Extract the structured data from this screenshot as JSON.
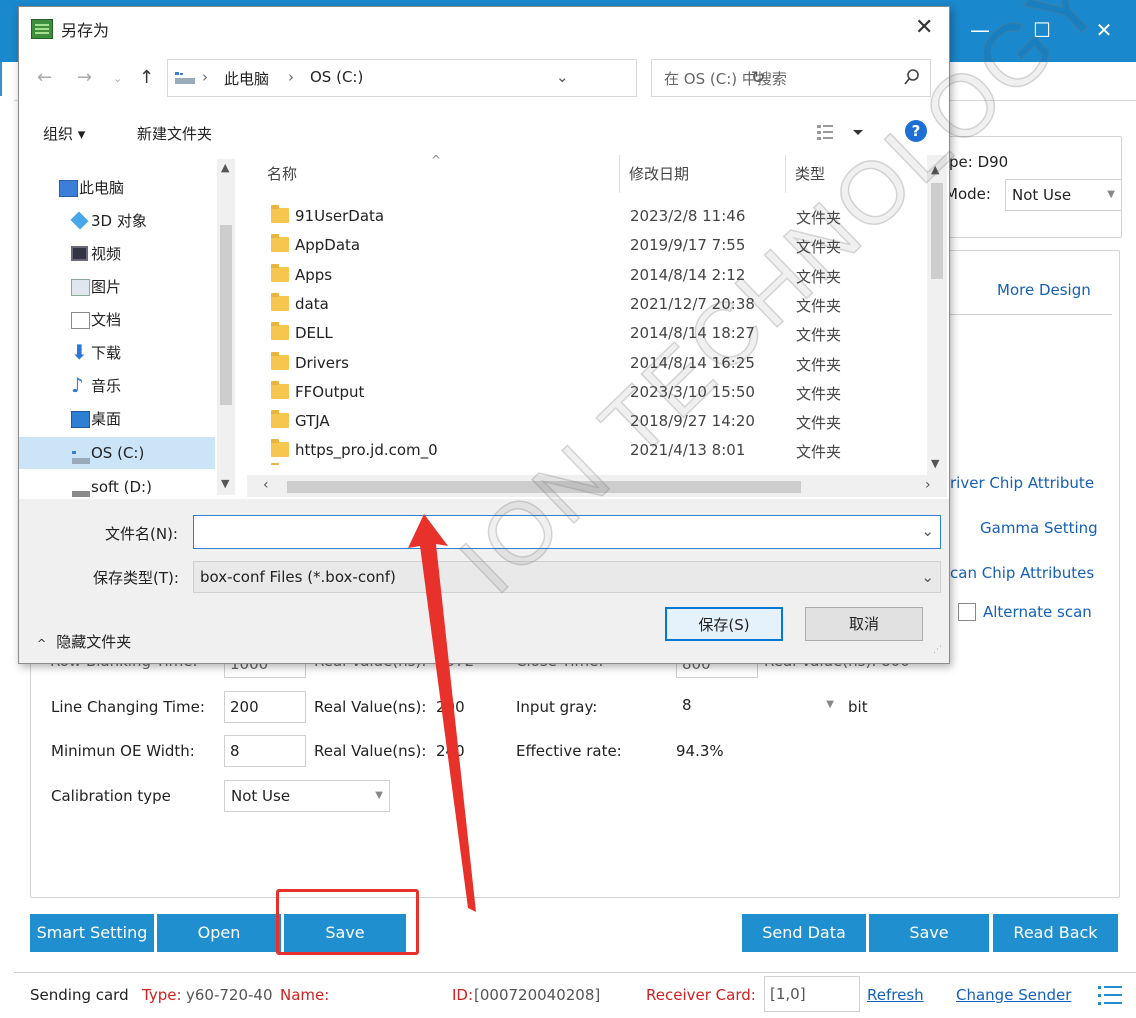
{
  "app": {
    "window_controls": {
      "minimize": "—",
      "maximize": "☐",
      "close": "✕"
    },
    "info_panel": {
      "type_label": "pe: D90",
      "mode_label": "Mode:",
      "mode_value": "Not Use"
    },
    "more_design": "More Design",
    "links": [
      "river Chip Attribute",
      "Gamma Setting",
      "can Chip Attributes"
    ],
    "alternate_scan": "Alternate scan",
    "partial_row": {
      "a": "Row Blanking Time:",
      "a_val": "1000",
      "b": "Real Value(ns):",
      "b_val": "1072",
      "c": "Close Time:",
      "c_val": "800",
      "d": "Real Value(ns): 800"
    },
    "fields": {
      "line_changing_label": "Line Changing Time:",
      "line_changing_value": "200",
      "real1_label": "Real Value(ns):",
      "real1_value": "200",
      "input_gray_label": "Input gray:",
      "input_gray_value": "8",
      "bit": "bit",
      "min_oe_label": "Minimun OE Width:",
      "min_oe_value": "8",
      "real2_label": "Real Value(ns):",
      "real2_value": "240",
      "effective_rate_label": "Effective rate:",
      "effective_rate_value": "94.3%",
      "calibration_label": "Calibration type",
      "calibration_value": "Not Use"
    },
    "buttons_left": [
      "Smart Setting",
      "Open",
      "Save"
    ],
    "buttons_right": [
      "Send Data",
      "Save",
      "Read Back"
    ],
    "status": {
      "sending_card": "Sending card",
      "type_label": "Type:",
      "type_value": "y60-720-40",
      "name_label": "Name:",
      "id_label": "ID:",
      "id_value": "[000720040208]",
      "receiver_label": "Receiver Card:",
      "receiver_value": "[1,0]",
      "refresh": "Refresh",
      "change_sender": "Change Sender"
    }
  },
  "dialog": {
    "title": "另存为",
    "breadcrumb": [
      "此电脑",
      "OS (C:)"
    ],
    "search_placeholder": "在 OS (C:) 中搜索",
    "toolbar": {
      "organize": "组织 ▾",
      "new_folder": "新建文件夹"
    },
    "tree": [
      "此电脑",
      "3D 对象",
      "视频",
      "图片",
      "文档",
      "下载",
      "音乐",
      "桌面",
      "OS (C:)",
      "soft (D:)"
    ],
    "columns": {
      "name": "名称",
      "date": "修改日期",
      "type": "类型"
    },
    "files": [
      {
        "name": "91UserData",
        "date": "2023/2/8 11:46",
        "type": "文件夹"
      },
      {
        "name": "AppData",
        "date": "2019/9/17 7:55",
        "type": "文件夹"
      },
      {
        "name": "Apps",
        "date": "2014/8/14 2:12",
        "type": "文件夹"
      },
      {
        "name": "data",
        "date": "2021/12/7 20:38",
        "type": "文件夹"
      },
      {
        "name": "DELL",
        "date": "2014/8/14 18:27",
        "type": "文件夹"
      },
      {
        "name": "Drivers",
        "date": "2014/8/14 16:25",
        "type": "文件夹"
      },
      {
        "name": "FFOutput",
        "date": "2023/3/10 15:50",
        "type": "文件夹"
      },
      {
        "name": "GTJA",
        "date": "2018/9/27 14:20",
        "type": "文件夹"
      },
      {
        "name": "https_pro.jd.com_0",
        "date": "2021/4/13 8:01",
        "type": "文件夹"
      }
    ],
    "filename_label": "文件名(N):",
    "filename_value": "",
    "filetype_label": "保存类型(T):",
    "filetype_value": "box-conf Files  (*.box-conf)",
    "hide_folders": "隐藏文件夹",
    "save_button": "保存(S)",
    "cancel_button": "取消"
  },
  "watermark": "ION TECHNOLOGY CO",
  "colors": {
    "accent": "#1f8fd0",
    "titlebar": "#1a88cc",
    "annotation": "#e8312b",
    "link": "#1560b8",
    "red_text": "#d02020"
  }
}
